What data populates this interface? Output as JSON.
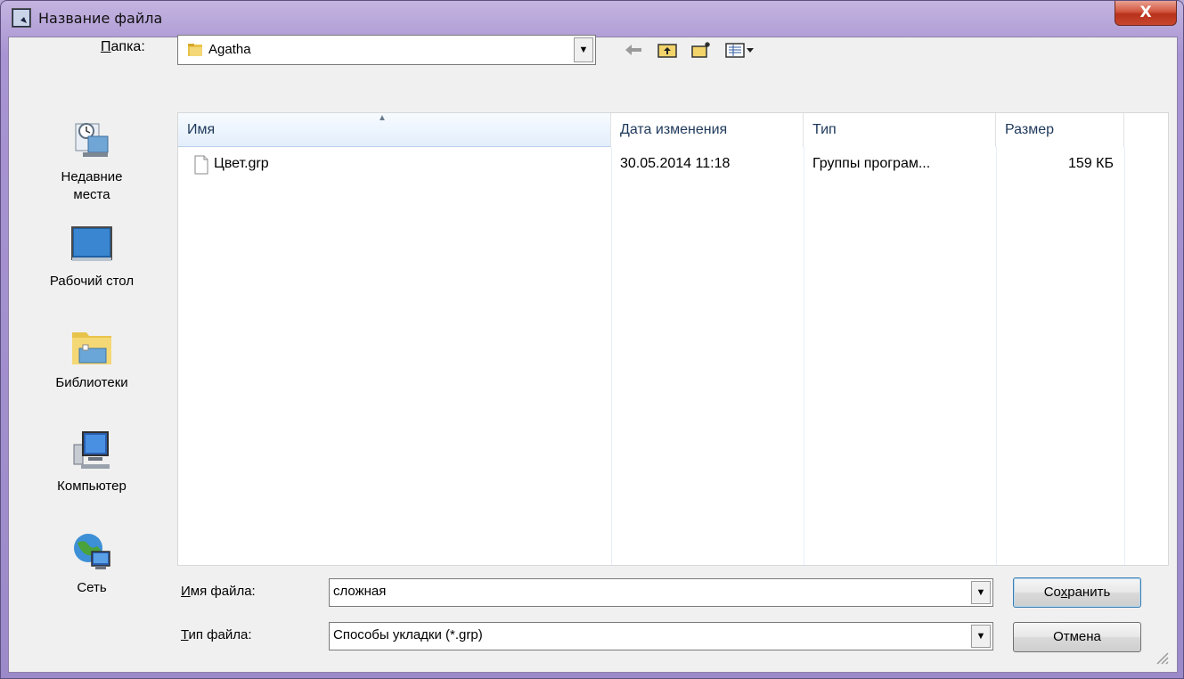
{
  "window": {
    "title": "Название файла",
    "close_label": "X"
  },
  "toolbar": {
    "look_in_label_u": "П",
    "look_in_label_rest": "апка:",
    "current_folder": "Agatha",
    "icons": [
      "back-arrow-icon",
      "up-folder-icon",
      "new-folder-icon",
      "view-menu-icon"
    ]
  },
  "places": [
    {
      "label": "Недавние\nместа",
      "icon": "recent-places-icon"
    },
    {
      "label": "Рабочий стол",
      "icon": "desktop-icon"
    },
    {
      "label": "Библиотеки",
      "icon": "libraries-icon"
    },
    {
      "label": "Компьютер",
      "icon": "computer-icon"
    },
    {
      "label": "Сеть",
      "icon": "network-icon"
    }
  ],
  "file_list": {
    "columns": [
      "Имя",
      "Дата изменения",
      "Тип",
      "Размер"
    ],
    "rows": [
      {
        "name": "Цвет.grp",
        "modified": "30.05.2014 11:18",
        "type": "Группы програм...",
        "size": "159 КБ"
      }
    ]
  },
  "form": {
    "filename_label_u": "И",
    "filename_label_rest": "мя файла:",
    "filename_value": "сложная",
    "filetype_label_u": "Т",
    "filetype_label_rest": "ип файла:",
    "filetype_value": "Способы укладки (*.grp)"
  },
  "buttons": {
    "save_pre": "Со",
    "save_u": "х",
    "save_post": "ранить",
    "cancel": "Отмена"
  },
  "colors": {
    "title_bar": "#a894d2",
    "close_button": "#c8462e",
    "header_sorted": "#e3eefb"
  }
}
